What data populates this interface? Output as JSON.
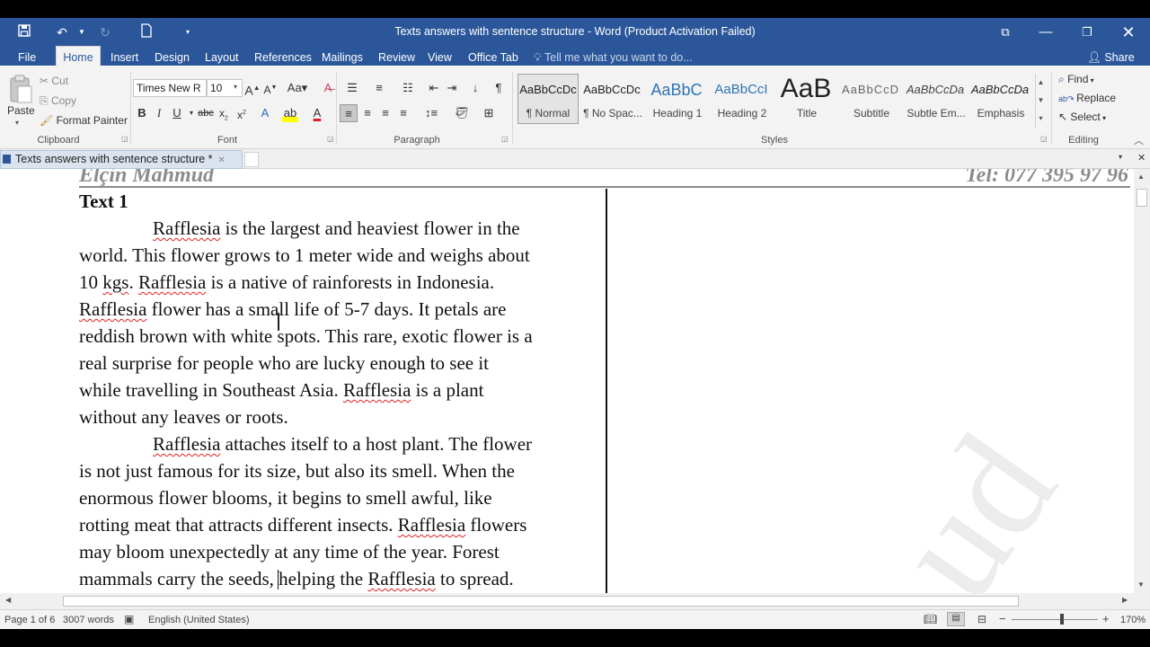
{
  "window": {
    "title": "Texts answers with sentence structure - Word (Product Activation Failed)"
  },
  "ribbon_tabs": [
    "File",
    "Home",
    "Insert",
    "Design",
    "Layout",
    "References",
    "Mailings",
    "Review",
    "View",
    "Office Tab"
  ],
  "tell_me": "Tell me what you want to do...",
  "share": "Share",
  "clipboard": {
    "paste": "Paste",
    "cut": "Cut",
    "copy": "Copy",
    "format_painter": "Format Painter",
    "group": "Clipboard"
  },
  "font": {
    "name": "Times New R",
    "size": "10",
    "group": "Font"
  },
  "paragraph": {
    "group": "Paragraph"
  },
  "styles": {
    "group": "Styles",
    "items": [
      {
        "preview": "AaBbCcDc",
        "name": "¶ Normal"
      },
      {
        "preview": "AaBbCcDc",
        "name": "¶ No Spac..."
      },
      {
        "preview": "AaBbC",
        "name": "Heading 1"
      },
      {
        "preview": "AaBbCcI",
        "name": "Heading 2"
      },
      {
        "preview": "AaB",
        "name": "Title"
      },
      {
        "preview": "AaBbCcD",
        "name": "Subtitle"
      },
      {
        "preview": "AaBbCcDa",
        "name": "Subtle Em..."
      },
      {
        "preview": "AaBbCcDa",
        "name": "Emphasis"
      }
    ]
  },
  "editing": {
    "find": "Find",
    "replace": "Replace",
    "select": "Select",
    "group": "Editing"
  },
  "doc_tab": "Texts answers with sentence structure *",
  "document": {
    "header_left": "Elçin Mahmud",
    "header_right": "Tel: 077 395 97 96",
    "heading": "Text 1",
    "lines": [
      "Rafflesia is the largest and heaviest flower in the",
      "world. This flower grows to 1 meter wide and weighs about",
      "10 kgs. Rafflesia is a native of rainforests in Indonesia.",
      "Rafflesia flower has a small life of 5-7 days. It petals are",
      "reddish brown with white spots. This rare, exotic flower is a",
      "real surprise for people who are lucky enough to see it",
      "while travelling in Southeast Asia. Rafflesia is a plant",
      "without any leaves or roots.",
      "Rafflesia attaches itself to a host plant. The flower",
      "is not just famous for its size, but also its smell. When the",
      "enormous flower blooms, it begins to smell awful, like",
      "rotting meat that attracts different insects. Rafflesia flowers",
      "may bloom unexpectedly at any time of the year. Forest",
      "mammals carry the seeds, helping the Rafflesia to spread."
    ]
  },
  "status": {
    "page": "Page 1 of 6",
    "words": "3007 words",
    "language": "English (United States)",
    "zoom": "170%"
  }
}
